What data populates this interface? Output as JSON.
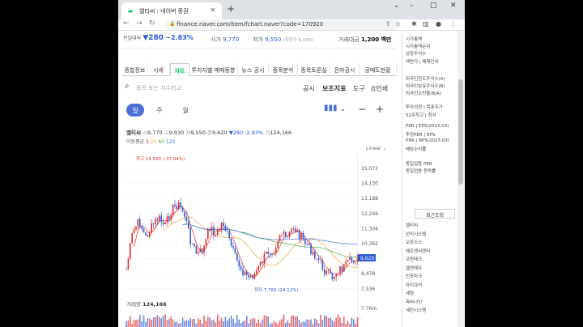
{
  "browser": {
    "tab_title": "엘티씨 : 네이버 증권",
    "url": "finance.naver.com/item/fchart.naver?code=170920"
  },
  "header": {
    "change_label": "전일대비",
    "price": "▼280",
    "change_pct": "−2.83%",
    "open_label": "시가",
    "open": "9,770",
    "low_label": "저가",
    "low": "9,550",
    "low_limit": "(하한가 6,930)",
    "vol_label": "거래대금",
    "vol_value": "1,200 백만"
  },
  "tabs": [
    "종합정보",
    "시세",
    "차트",
    "투자자별 매매동향",
    "뉴스 공시",
    "종목분석",
    "종목토론실",
    "전자공시",
    "공매도현황"
  ],
  "search": {
    "placeholder": "종목 또는 지수비교",
    "tools": [
      "공시",
      "보조지표",
      "도구",
      "인쇄"
    ]
  },
  "periods": [
    "일",
    "주",
    "월"
  ],
  "info": {
    "name": "엘티씨",
    "o_label": "시",
    "o": "9,770",
    "h_label": "고",
    "h": "9,930",
    "l_label": "저",
    "l": "9,550",
    "c_label": "종",
    "c": "9,620",
    "chg": "▼280",
    "pct": "-2.83%",
    "v_label": "거",
    "v": "124,166"
  },
  "ma": {
    "label": "이동평균",
    "values": [
      "5",
      "20",
      "60",
      "120"
    ]
  },
  "linear": "Linear",
  "volume": {
    "label": "거래량",
    "value": "124,166"
  },
  "chart_data": {
    "type": "line",
    "yticks": [
      "15,072",
      "14,130",
      "13,188",
      "12,246",
      "11,304",
      "10,362",
      "9,420",
      "8,478",
      "7,536"
    ],
    "vol_tick": "7.76m",
    "high_label": "최고 15,500 (-37.94%)",
    "low_label": "최저 7,760 (24.12%)",
    "current": "9,620",
    "ylim": [
      7536,
      15500
    ]
  },
  "right": {
    "items": [
      "시가총액",
      "시가총액순위",
      "상장주식수",
      "액면가 | 매매단위",
      "외국인한도주식수(A)",
      "외국인보유주식수(B)",
      "외국인소진율(B/A)",
      "투자의견 | 목표주가",
      "52주최고 | 최저",
      "PER | EPS(2023.03)",
      "추정PER | EPS",
      "PBR | BPS(2023.03)",
      "배당수익률",
      "동일업종 PER",
      "동일업종 등락률"
    ],
    "recent_label": "최근조회",
    "recent": [
      "엘티씨",
      "선익시스템",
      "오픈소스",
      "에프엔씨엔터",
      "코윈테크",
      "엘앤에프",
      "인포마크",
      "아이큐어",
      "세원",
      "파버나인",
      "세진시스템"
    ]
  }
}
